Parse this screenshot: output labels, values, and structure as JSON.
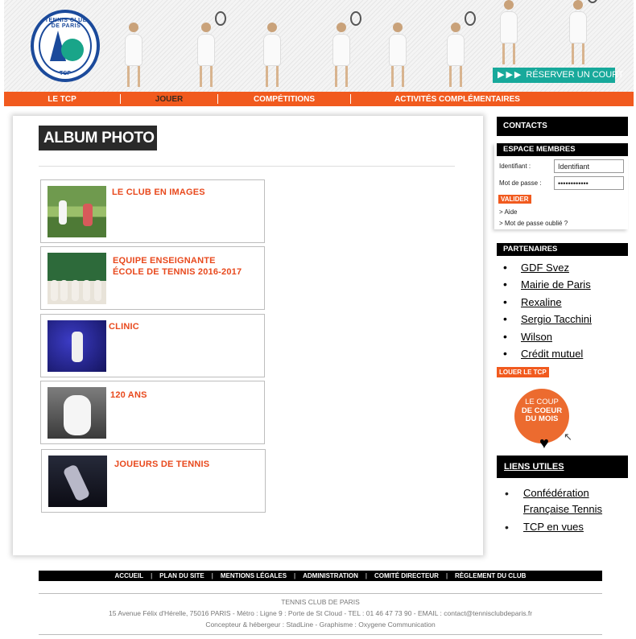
{
  "header": {
    "logo_text": "TENNIS CLUB DE PARIS",
    "logo_abbr": "TCP",
    "book_court_arrows": "▶▶▶",
    "book_court_label": "RÉSERVER UN COURT"
  },
  "nav": {
    "items": [
      {
        "label": "LE TCP",
        "active": false
      },
      {
        "label": "JOUER",
        "active": true
      },
      {
        "label": "COMPÉTITIONS",
        "active": false
      },
      {
        "label": "ACTIVITÉS COMPLÉMENTAIRES",
        "active": false
      }
    ]
  },
  "main": {
    "title": "ALBUM PHOTO",
    "albums": [
      {
        "title_line1": "LE CLUB EN IMAGES",
        "title_line2": ""
      },
      {
        "title_line1": "EQUIPE ENSEIGNANTE",
        "title_line2": "ÉCOLE DE TENNIS 2016-2017"
      },
      {
        "title_line1": "CLINIC",
        "title_line2": ""
      },
      {
        "title_line1": "120 ANS",
        "title_line2": ""
      },
      {
        "title_line1": "JOUEURS DE TENNIS",
        "title_line2": ""
      }
    ]
  },
  "sidebar": {
    "contacts": "CONTACTS",
    "members": {
      "title": "ESPACE MEMBRES",
      "id_label": "Identifiant :",
      "id_value": "Identifiant",
      "pw_label": "Mot de passe :",
      "pw_value": "••••••••••••",
      "validate": "VALIDER",
      "help": "> Aide",
      "forgot": "> Mot de passe oublié ?"
    },
    "partners_title": "PARTENAIRES",
    "partners": [
      "GDF Svez",
      "Mairie de Paris",
      "Rexaline",
      "Sergio Tacchini",
      "Wilson",
      "Crédit mutuel"
    ],
    "rent": "LOUER LE TCP",
    "coup": {
      "line1": "LE COUP",
      "line2": "DE COEUR",
      "line3": "DU MOIS"
    },
    "useful_title": "LIENS UTILES",
    "useful_links": [
      "Confédération Française Tennis",
      "TCP en vues"
    ]
  },
  "footer": {
    "nav": [
      "ACCUEIL",
      "PLAN DU SITE",
      "MENTIONS LÉGALES",
      "ADMINISTRATION",
      "COMITÉ DIRECTEUR",
      "RÈGLEMENT DU CLUB"
    ],
    "org": "TENNIS CLUB DE PARIS",
    "address": "15 Avenue Félix d'Hérelle, 75016 PARIS - Métro : Ligne 9 : Porte de St Cloud - TEL : 01 46 47 73 90 - EMAIL : contact@tennisclubdeparis.fr",
    "credits": "Concepteur & hébergeur : StadLine - Graphisme : Oxygene Communication"
  },
  "colors": {
    "accent": "#f15a1e",
    "teal": "#18a99b",
    "navy": "#1b4a9b"
  }
}
